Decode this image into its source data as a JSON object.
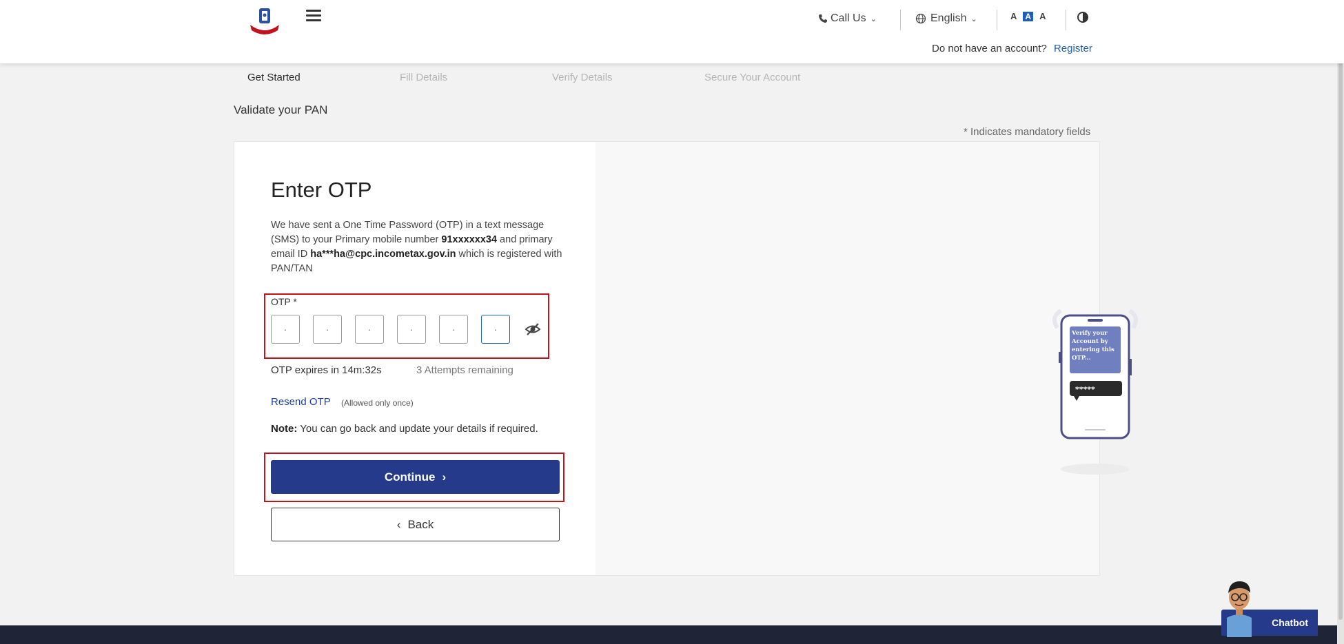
{
  "header": {
    "call_us": "Call Us",
    "language": "English",
    "font_controls": [
      "A",
      "A",
      "A"
    ],
    "account_prompt": "Do not have an account?",
    "register": "Register"
  },
  "steps": [
    {
      "label": "Get Started",
      "state": "active"
    },
    {
      "label": "Fill Details",
      "state": "inactive"
    },
    {
      "label": "Verify Details",
      "state": "inactive"
    },
    {
      "label": "Secure Your Account",
      "state": "inactive"
    }
  ],
  "page": {
    "section_title": "Validate your PAN",
    "mandatory_note": "* Indicates mandatory fields"
  },
  "otp": {
    "title": "Enter OTP",
    "desc_1": "We have sent a One Time Password (OTP) in a text message (SMS) to your Primary mobile number ",
    "mobile": "91xxxxxx34",
    "desc_2": " and primary email ID ",
    "email": "ha***ha@cpc.incometax.gov.in",
    "desc_3": " which is registered with PAN/TAN",
    "label": "OTP *",
    "cells": [
      "·",
      "·",
      "·",
      "·",
      "·",
      "·"
    ],
    "expiry": "OTP expires in 14m:32s",
    "attempts": "3 Attempts remaining",
    "resend": "Resend OTP",
    "resend_note": "(Allowed only once)",
    "note_label": "Note:",
    "note_text": " You can go back and update your details if required.",
    "continue": "Continue",
    "back": "Back"
  },
  "illustration": {
    "message": "Verify your Account by entering this OTP...",
    "masked": "*****"
  },
  "chatbot": {
    "label": "Chatbot"
  },
  "colors": {
    "primary": "#263a8c",
    "highlight": "#c0131b",
    "link": "#1d5fb8"
  }
}
